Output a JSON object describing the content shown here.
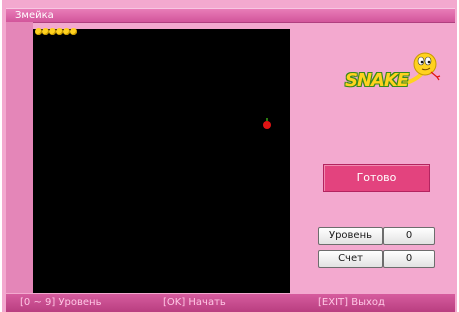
{
  "window": {
    "title": "Змейка"
  },
  "game": {
    "snake_segments": 6,
    "apple": "apple-icon"
  },
  "logo": {
    "text": "SNAKE",
    "mascot": "snake-mascot-icon"
  },
  "status": {
    "ready_label": "Готово"
  },
  "stats": {
    "level_label": "Уровень",
    "level_value": "0",
    "score_label": "Счет",
    "score_value": "0"
  },
  "footer": {
    "hint_level": "[0 ~ 9]  Уровень",
    "hint_start": "[OK]  Начать",
    "hint_exit": "[EXIT]  Выход"
  },
  "colors": {
    "background": "#f3a9cf",
    "titlebar": "#d2559b",
    "board": "#000000",
    "snake": "#ffd21f",
    "apple": "#e01414",
    "ready_button": "#e3437e"
  }
}
